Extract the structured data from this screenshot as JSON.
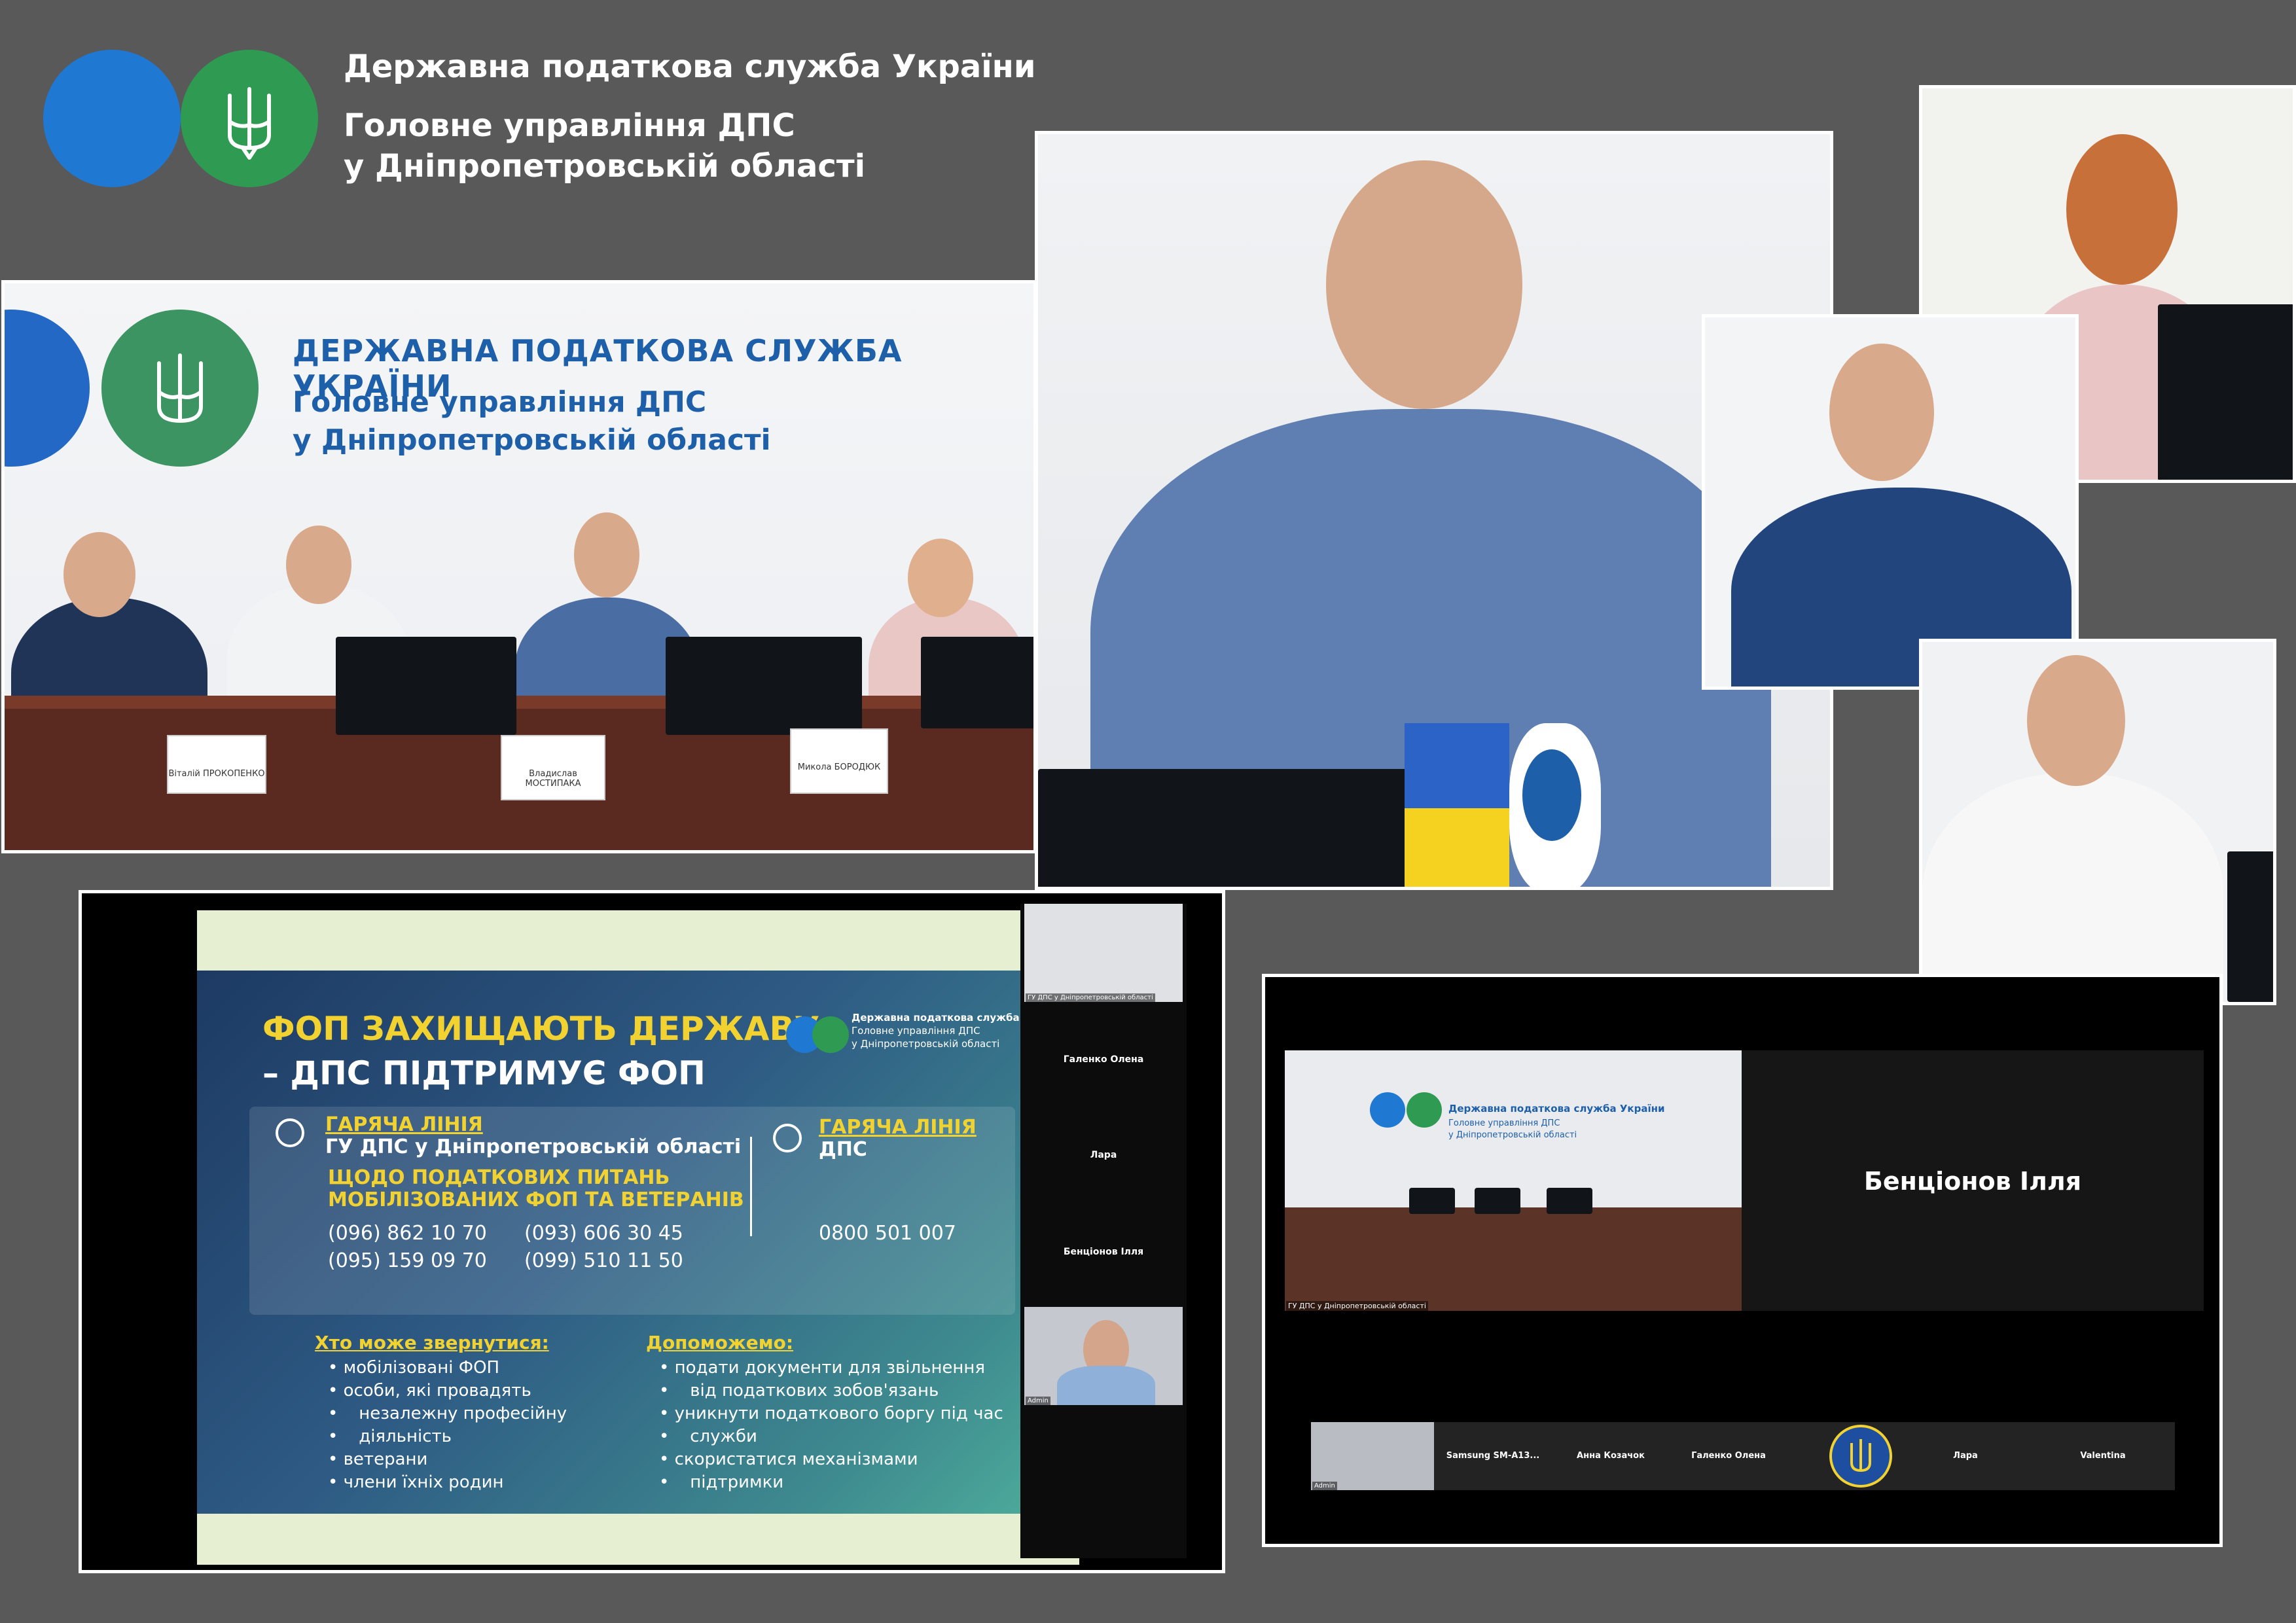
{
  "header": {
    "line1": "Державна податкова служба України",
    "line2": "Головне управління ДПС",
    "line3": "у Дніпропетровській області"
  },
  "photo_press": {
    "title": "ДЕРЖАВНА ПОДАТКОВА СЛУЖБА УКРАЇНИ",
    "sub1": "Головне управління ДПС",
    "sub2": "у Дніпропетровській області",
    "nameplates": [
      "Віталій ПРОКОПЕНКО",
      "Владислав МОСТИПАКА",
      "Микола БОРОДЮК"
    ]
  },
  "slide": {
    "title1": "ФОП ЗАХИЩАЮТЬ ДЕРЖАВУ",
    "title2": "– ДПС ПІДТРИМУЄ ФОП",
    "org1": "Державна податкова служба України",
    "org2": "Головне управління ДПС",
    "org3": "у Дніпропетровській області",
    "hotline1_title": "ГАРЯЧА ЛІНІЯ",
    "hotline1_sub": "ГУ ДПС у Дніпропетровській області",
    "topic1": "ЩОДО ПОДАТКОВИХ ПИТАНЬ",
    "topic2": "МОБІЛІЗОВАНИХ ФОП ТА ВЕТЕРАНІВ",
    "phones": [
      "(096) 862 10 70",
      "(093) 606 30 45",
      "(095) 159 09 70",
      "(099) 510 11 50"
    ],
    "hotline2_title": "ГАРЯЧА ЛІНІЯ",
    "hotline2_sub": "ДПС",
    "hotline2_phone": "0800 501 007",
    "who_title": "Хто може звернутися:",
    "who": [
      "мобілізовані ФОП",
      "особи, які провадять",
      "незалежну професійну",
      "діяльність",
      "ветерани",
      "члени їхніх родин"
    ],
    "help_title": "Допоможемо:",
    "help": [
      "подати документи для звільнення",
      "від податкових зобов'язань",
      "уникнути податкового боргу під час",
      "служби",
      "скористатися механізмами",
      "підтримки"
    ]
  },
  "zoom1": {
    "caption_top": "ГУ ДПС у Дніпропетровській області",
    "p1": "Галенко Олена",
    "p2": "Лара",
    "p3": "Бенціонов Ілля",
    "admin": "Admin"
  },
  "zoom2": {
    "speaker": "Бенціонов Ілля",
    "caption": "ГУ ДПС у Дніпропетровській області",
    "org1": "Державна податкова служба України",
    "org2": "Головне управління ДПС",
    "org3": "у Дніпропетровській області",
    "strip": [
      "Admin",
      "Samsung  SM-A13...",
      "Анна Козачок",
      "Галенко Олена",
      "Лара",
      "Valentina"
    ]
  },
  "colors": {
    "background": "#595959",
    "brand_blue": "#1f78d1",
    "brand_green": "#2e9a52",
    "slide_yellow": "#f2d231"
  }
}
